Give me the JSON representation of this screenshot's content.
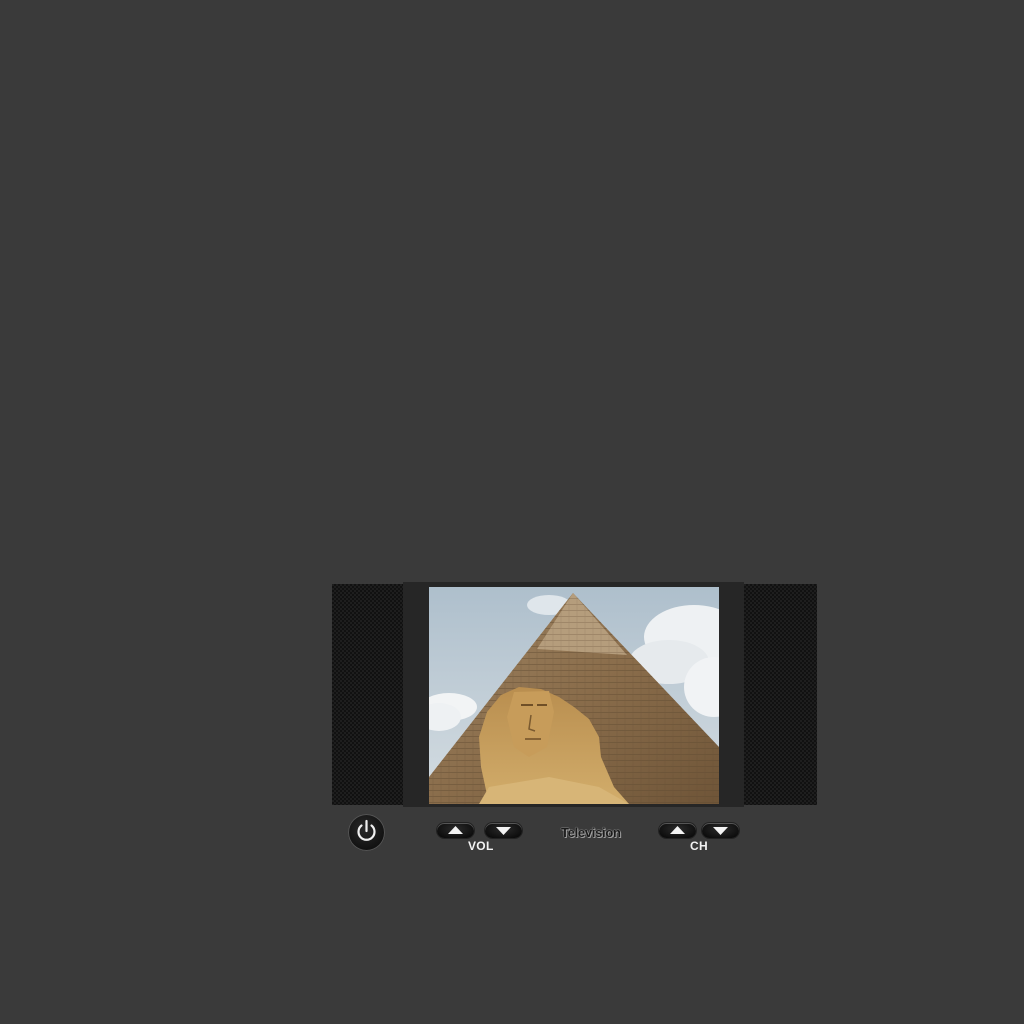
{
  "tv": {
    "brand": "Television",
    "screen_content": "pyramid-and-sphinx-image",
    "volume": {
      "label": "VOL",
      "up_icon": "triangle-up-icon",
      "down_icon": "triangle-down-icon"
    },
    "channel": {
      "label": "CH",
      "up_icon": "triangle-up-icon",
      "down_icon": "triangle-down-icon"
    },
    "power_icon": "power-icon"
  },
  "colors": {
    "background": "#3a3a3a",
    "bezel": "#262626",
    "speaker": "#1e1e1e",
    "button": "#111111",
    "label_text": "#f2f2f2"
  }
}
